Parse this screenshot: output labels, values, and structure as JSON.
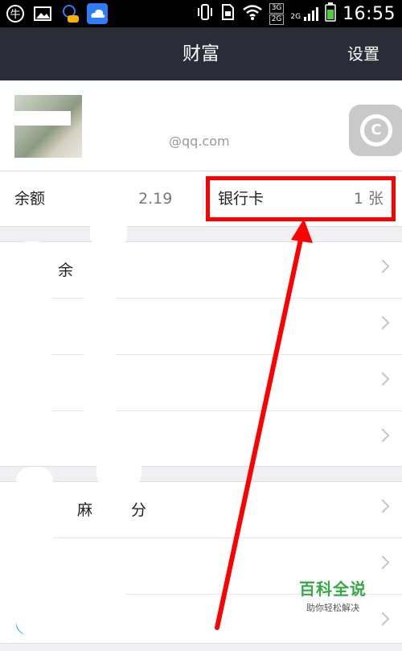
{
  "status_bar": {
    "time": "16:55",
    "network_badge_top": "3G",
    "network_badge_bottom": "2G",
    "network_badge_side": "2G",
    "left_icons": [
      "niu-icon",
      "image-icon",
      "qq-chat-icon",
      "cloud-icon"
    ],
    "right_icons": [
      "vibrate-icon",
      "sim-icon",
      "wifi-icon",
      "signal-icon",
      "battery-icon"
    ]
  },
  "title_bar": {
    "title": "财富",
    "settings_label": "设置"
  },
  "account": {
    "email": "@qq.com",
    "badge_icon": "qr-badge-icon"
  },
  "balance": {
    "label": "余额",
    "value": "2.19"
  },
  "bank_card": {
    "label": "银行卡",
    "count": "1 张",
    "highlight_color": "#ff0000"
  },
  "group1": {
    "items": [
      {
        "icon": "orange-icon",
        "label": "余",
        "hint": ""
      },
      {
        "icon": "orange-icon",
        "label": "",
        "hint": ""
      },
      {
        "icon": "orange-icon",
        "label": "",
        "hint": ""
      },
      {
        "icon": "orange-icon",
        "label": "",
        "hint": ""
      }
    ]
  },
  "group2": {
    "items": [
      {
        "icon": "blue-icon",
        "label": "麻",
        "hint": "分"
      },
      {
        "icon": "blue-icon",
        "label": "",
        "hint": ""
      },
      {
        "icon": "blue-icon",
        "label": "",
        "hint": ""
      }
    ]
  },
  "watermark": {
    "title": "百科全说",
    "subtitle": "助你轻松解决"
  },
  "colors": {
    "title_bar": "#2a2d37",
    "accent_orange": "#ff6a00",
    "accent_blue": "#1a9cf2",
    "annotation_red": "#ff0000",
    "watermark_green": "#35a946"
  }
}
